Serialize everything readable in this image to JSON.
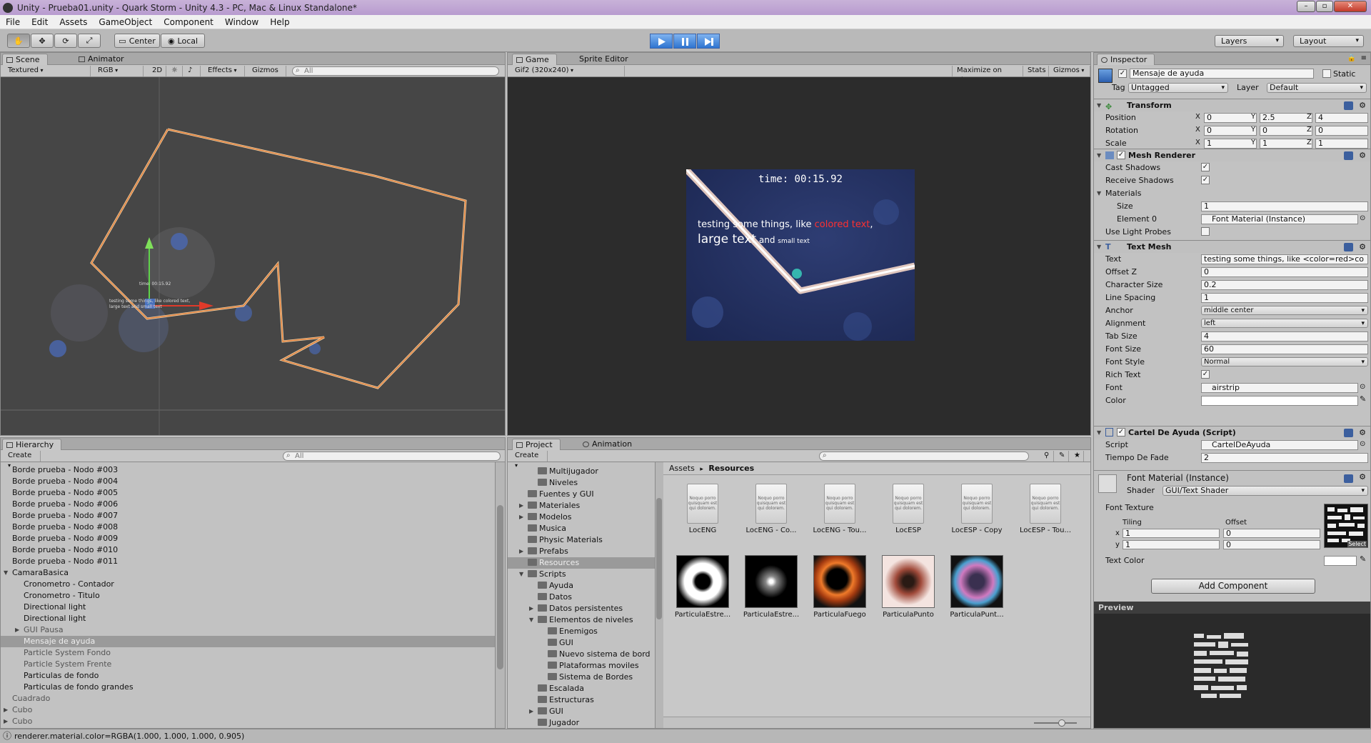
{
  "window": {
    "title": "Unity - Prueba01.unity - Quark Storm - Unity 4.3 - PC, Mac & Linux Standalone*",
    "menu": [
      "File",
      "Edit",
      "Assets",
      "GameObject",
      "Component",
      "Window",
      "Help"
    ]
  },
  "toolbar": {
    "pivot": "Center",
    "space": "Local",
    "layers": "Layers",
    "layout": "Layout"
  },
  "scene": {
    "tabs": [
      "Scene",
      "Animator"
    ],
    "draw_mode": "Textured",
    "render_mode": "RGB",
    "mode_2d": "2D",
    "effects": "Effects",
    "gizmos": "Gizmos",
    "search_placeholder": "All",
    "label_time": "time: 00:15.92",
    "label_text1": "testing some things, like colored text,",
    "label_text2": "large text and small text"
  },
  "game": {
    "tabs": [
      "Game",
      "Sprite Editor"
    ],
    "aspect": "Gif2 (320x240)",
    "maximize": "Maximize on Play",
    "stats": "Stats",
    "gizmos": "Gizmos",
    "time": "time: 00:15.92",
    "line1_a": "testing some things, like ",
    "line1_b": "colored text",
    "line1_c": ",",
    "line2_a": "large text",
    "line2_b": " and ",
    "line2_c": "small text"
  },
  "hierarchy": {
    "tab": "Hierarchy",
    "create": "Create",
    "search_placeholder": "All",
    "items": [
      {
        "label": "Borde prueba - Nodo #003",
        "indent": 0
      },
      {
        "label": "Borde prueba - Nodo #004",
        "indent": 0
      },
      {
        "label": "Borde prueba - Nodo #005",
        "indent": 0
      },
      {
        "label": "Borde prueba - Nodo #006",
        "indent": 0
      },
      {
        "label": "Borde prueba - Nodo #007",
        "indent": 0
      },
      {
        "label": "Borde prueba - Nodo #008",
        "indent": 0
      },
      {
        "label": "Borde prueba - Nodo #009",
        "indent": 0
      },
      {
        "label": "Borde prueba - Nodo #010",
        "indent": 0
      },
      {
        "label": "Borde prueba - Nodo #011",
        "indent": 0
      },
      {
        "label": "CamaraBasica",
        "indent": 0
      },
      {
        "label": "Cronometro - Contador",
        "indent": 1
      },
      {
        "label": "Cronometro - Titulo",
        "indent": 1
      },
      {
        "label": "Directional light",
        "indent": 1
      },
      {
        "label": "Directional light",
        "indent": 1
      },
      {
        "label": "GUI Pausa",
        "indent": 1
      },
      {
        "label": "Mensaje de ayuda",
        "indent": 1
      },
      {
        "label": "Particle System Fondo",
        "indent": 1
      },
      {
        "label": "Particle System Frente",
        "indent": 1
      },
      {
        "label": "Particulas de fondo",
        "indent": 1
      },
      {
        "label": "Particulas de fondo grandes",
        "indent": 1
      },
      {
        "label": "Cuadrado",
        "indent": 0
      },
      {
        "label": "Cubo",
        "indent": 0
      },
      {
        "label": "Cubo",
        "indent": 0
      }
    ]
  },
  "project": {
    "tabs": [
      "Project",
      "Animation"
    ],
    "create": "Create",
    "breadcrumb_root": "Assets",
    "breadcrumb_current": "Resources",
    "tree": [
      {
        "label": "Multijugador",
        "indent": 2
      },
      {
        "label": "Niveles",
        "indent": 2
      },
      {
        "label": "Fuentes y GUI",
        "indent": 1
      },
      {
        "label": "Materiales",
        "indent": 1
      },
      {
        "label": "Modelos",
        "indent": 1
      },
      {
        "label": "Musica",
        "indent": 1
      },
      {
        "label": "Physic Materials",
        "indent": 1
      },
      {
        "label": "Prefabs",
        "indent": 1
      },
      {
        "label": "Resources",
        "indent": 1
      },
      {
        "label": "Scripts",
        "indent": 1
      },
      {
        "label": "Ayuda",
        "indent": 2
      },
      {
        "label": "Datos",
        "indent": 2
      },
      {
        "label": "Datos persistentes",
        "indent": 2
      },
      {
        "label": "Elementos de niveles",
        "indent": 2
      },
      {
        "label": "Enemigos",
        "indent": 3
      },
      {
        "label": "GUI",
        "indent": 3
      },
      {
        "label": "Nuevo sistema de bord",
        "indent": 3
      },
      {
        "label": "Plataformas moviles",
        "indent": 3
      },
      {
        "label": "Sistema de Bordes",
        "indent": 3
      },
      {
        "label": "Escalada",
        "indent": 2
      },
      {
        "label": "Estructuras",
        "indent": 2
      },
      {
        "label": "GUI",
        "indent": 2
      },
      {
        "label": "Jugador",
        "indent": 2
      }
    ],
    "assets_row1": [
      "LocENG",
      "LocENG - Co...",
      "LocENG - Tou...",
      "LocESP",
      "LocESP - Copy",
      "LocESP - Tou..."
    ],
    "assets_row2": [
      "ParticulaEstre...",
      "ParticulaEstre...",
      "ParticulaFuego",
      "ParticulaPunto",
      "ParticulaPunt..."
    ],
    "doc_text": "Noquo porro quisquam est qui dolorem."
  },
  "inspector": {
    "tab": "Inspector",
    "object_name": "Mensaje de ayuda",
    "static_label": "Static",
    "tag_label": "Tag",
    "tag_value": "Untagged",
    "layer_label": "Layer",
    "layer_value": "Default",
    "transform": {
      "title": "Transform",
      "position_label": "Position",
      "position": [
        "0",
        "2.5",
        "4"
      ],
      "rotation_label": "Rotation",
      "rotation": [
        "0",
        "0",
        "0"
      ],
      "scale_label": "Scale",
      "scale": [
        "1",
        "1",
        "1"
      ]
    },
    "mesh_renderer": {
      "title": "Mesh Renderer",
      "cast_shadows": "Cast Shadows",
      "receive_shadows": "Receive Shadows",
      "materials": "Materials",
      "size_label": "Size",
      "size": "1",
      "element0_label": "Element 0",
      "element0": "Font Material (Instance)",
      "light_probes": "Use Light Probes"
    },
    "text_mesh": {
      "title": "Text Mesh",
      "text_label": "Text",
      "text": "testing some things, like <color=red>co",
      "offset_label": "Offset Z",
      "offset": "0",
      "char_size_label": "Character Size",
      "char_size": "0.2",
      "line_spacing_label": "Line Spacing",
      "line_spacing": "1",
      "anchor_label": "Anchor",
      "anchor": "middle center",
      "alignment_label": "Alignment",
      "alignment": "left",
      "tab_size_label": "Tab Size",
      "tab_size": "4",
      "font_size_label": "Font Size",
      "font_size": "60",
      "font_style_label": "Font Style",
      "font_style": "Normal",
      "rich_text_label": "Rich Text",
      "font_label": "Font",
      "font": "airstrip",
      "color_label": "Color"
    },
    "cartel": {
      "title": "Cartel De Ayuda (Script)",
      "script_label": "Script",
      "script": "CartelDeAyuda",
      "fade_label": "Tiempo De Fade",
      "fade": "2"
    },
    "material": {
      "title": "Font Material (Instance)",
      "shader_label": "Shader",
      "shader": "GUI/Text Shader",
      "font_texture": "Font Texture",
      "tiling": "Tiling",
      "offset": "Offset",
      "x": "x",
      "y": "y",
      "tiling_x": "1",
      "tiling_y": "1",
      "offset_x": "0",
      "offset_y": "0",
      "select": "Select",
      "text_color": "Text Color"
    },
    "add_component": "Add Component",
    "preview": "Preview"
  },
  "status": "renderer.material.color=RGBA(1.000, 1.000, 1.000, 0.905)"
}
